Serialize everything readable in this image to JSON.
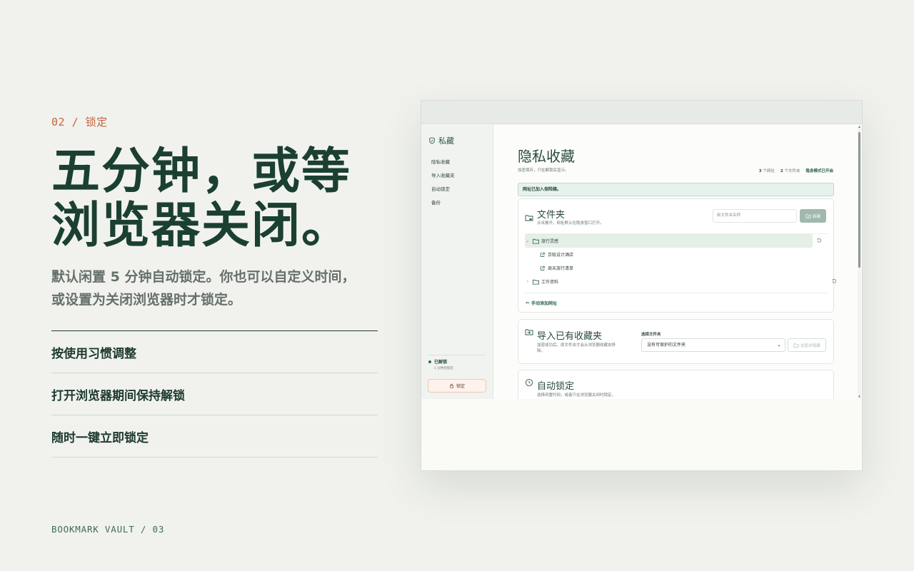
{
  "slide": {
    "eyebrow": "02 / 锁定",
    "headline_line1": "五分钟，或等",
    "headline_line2": "浏览器关闭。",
    "subtitle_line1": "默认闲置 5 分钟自动锁定。你也可以自定义时间，",
    "subtitle_line2": "或设置为关闭浏览器时才锁定。",
    "features": [
      "按使用习惯调整",
      "打开浏览器期间保持解锁",
      "随时一键立即锁定"
    ],
    "footer": "BOOKMARK VAULT / 03"
  },
  "app": {
    "brand": "私藏",
    "nav": [
      "隐私收藏",
      "导入收藏夹",
      "自动锁定",
      "备份"
    ],
    "status": "已解锁",
    "status_sub": "1 分钟后锁定",
    "lock_button": "锁定",
    "page_title": "隐私收藏",
    "page_subtitle": "加密保存，只在解锁后显示。",
    "stats": {
      "url_count": "3",
      "url_label": "个网址",
      "folder_count": "2",
      "folder_label": "个文件夹",
      "incognito": "隐身模式已开启"
    },
    "notice": "网址已加入保险箱。",
    "folders_card": {
      "title": "文件夹",
      "desc": "点击展开，网址默认在隐身窗口打开。",
      "input_placeholder": "新文件夹名称",
      "new_button": "新建",
      "tree": [
        {
          "label": "旅行灵感",
          "selected": true,
          "expanded": true
        },
        {
          "label": "京阪设计酒店",
          "child": true
        },
        {
          "label": "周末旅行清单",
          "child": true
        },
        {
          "label": "工作资料",
          "selected": false,
          "expanded": false
        }
      ],
      "add_link": "手动添加网址"
    },
    "import_card": {
      "title": "导入已有收藏夹",
      "desc_line1": "加密成功后，原文件夹才会从浏览器收藏夹移",
      "desc_line2": "除。",
      "select_label": "选择文件夹",
      "select_value": "没有可保护的文件夹",
      "protect_button": "加密并隐藏"
    },
    "autolock_card": {
      "title": "自动锁定",
      "desc": "选择闲置时间，或者只在浏览器关闭时锁定。"
    }
  },
  "colors": {
    "background": "#f1f2ee",
    "accent_orange": "#c4643e",
    "headline_green": "#1b4032",
    "brand_green": "#2d5a48"
  }
}
